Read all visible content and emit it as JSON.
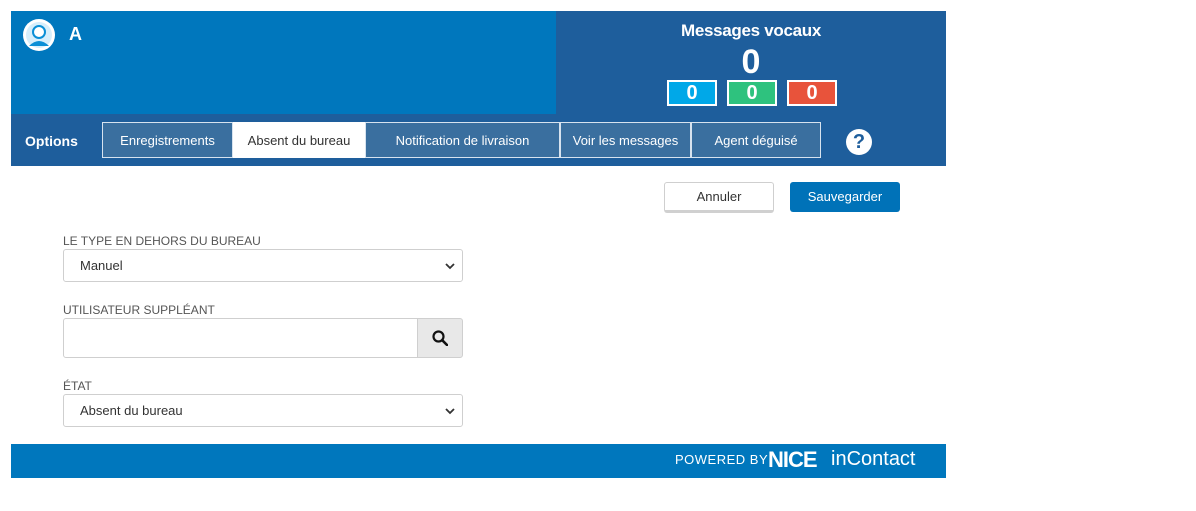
{
  "header": {
    "user_name": "A",
    "icons": {
      "avatar": "user-avatar-icon"
    }
  },
  "voicemail": {
    "title": "Messages vocaux",
    "total": "0",
    "counters": [
      {
        "value": "0",
        "color": "#00a8e8"
      },
      {
        "value": "0",
        "color": "#2ec27e"
      },
      {
        "value": "0",
        "color": "#e8533b"
      }
    ]
  },
  "tabbar": {
    "options_label": "Options",
    "tabs": [
      {
        "label": "Enregistrements",
        "active": false
      },
      {
        "label": "Absent du bureau",
        "active": true
      },
      {
        "label": "Notification de livraison",
        "active": false
      },
      {
        "label": "Voir les messages",
        "active": false
      },
      {
        "label": "Agent déguisé",
        "active": false
      }
    ],
    "help_label": "?"
  },
  "actions": {
    "cancel_label": "Annuler",
    "save_label": "Sauvegarder"
  },
  "form": {
    "ooo_type": {
      "label": "LE TYPE EN DEHORS DU BUREAU",
      "value": "Manuel"
    },
    "substitute": {
      "label": "UTILISATEUR SUPPLÉANT",
      "value": ""
    },
    "state": {
      "label": "ÉTAT",
      "value": "Absent du bureau"
    }
  },
  "footer": {
    "powered_by": "POWERED BY",
    "brand_nice": "NICE",
    "brand_incontact": "inContact"
  },
  "colors": {
    "header_blue": "#0077bd",
    "panel_blue": "#1e5e9c",
    "primary_button": "#0072b8"
  }
}
